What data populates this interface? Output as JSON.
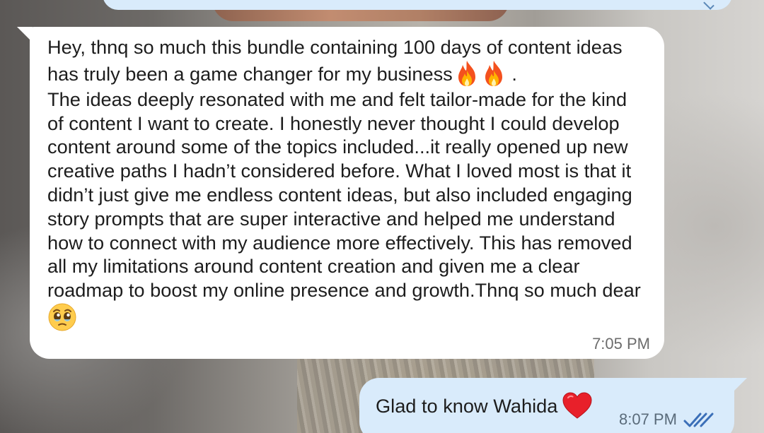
{
  "chat": {
    "incoming": {
      "text": "Hey, thnq so much this bundle containing 100 days of content ideas has truly been a game changer for my business",
      "emoji_1": "fire-emoji",
      "emoji_2": "fire-emoji",
      "after_emoji": " .",
      "text_2": "The ideas deeply resonated with me and felt tailor-made for the kind of content I want to create. I honestly never thought I could develop content around some of the topics included...it really opened up new creative paths I hadn’t considered before. What I loved most is that it didn’t just give me endless content ideas, but also included engaging story prompts that are super interactive and helped me understand how to connect with my audience more effectively. This has removed all my limitations around content creation and given me a clear roadmap to boost my online presence and growth.Thnq so much dear",
      "emoji_3": "pleading-face-emoji",
      "time": "7:05 PM"
    },
    "outgoing": {
      "text": "Glad to know Wahida",
      "emoji": "red-heart-emoji",
      "time": "8:07 PM",
      "status": "read-double-tick-icon"
    }
  },
  "colors": {
    "incoming_bubble": "#ffffff",
    "outgoing_bubble": "#d9ebfb",
    "read_tick": "#3b6fb8",
    "timestamp": "#6c6c6c"
  }
}
